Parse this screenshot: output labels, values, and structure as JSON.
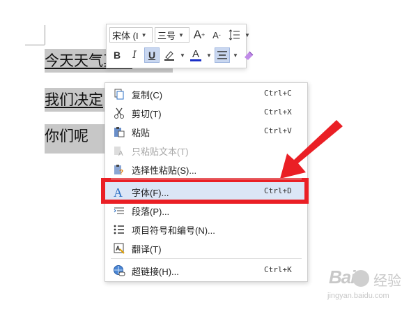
{
  "document": {
    "lines": [
      "今天天气真好",
      "我们决定",
      "你们呢"
    ]
  },
  "mini_toolbar": {
    "font_name": "宋体 (I",
    "font_size": "三号",
    "grow_font": "A",
    "shrink_font": "A",
    "bold": "B",
    "italic": "I",
    "underline": "U",
    "font_color": "A"
  },
  "context_menu": {
    "items": [
      {
        "label": "复制(C)",
        "shortcut": "Ctrl+C",
        "icon": "copy-icon",
        "enabled": true
      },
      {
        "label": "剪切(T)",
        "shortcut": "Ctrl+X",
        "icon": "scissors-icon",
        "enabled": true
      },
      {
        "label": "粘贴",
        "shortcut": "Ctrl+V",
        "icon": "paste-icon",
        "enabled": true
      },
      {
        "label": "只粘贴文本(T)",
        "shortcut": "",
        "icon": "paste-text-icon",
        "enabled": false
      },
      {
        "label": "选择性粘贴(S)...",
        "shortcut": "",
        "icon": "paste-special-icon",
        "enabled": true
      },
      {
        "label": "字体(F)...",
        "shortcut": "Ctrl+D",
        "icon": "font-icon",
        "enabled": true,
        "highlighted": true
      },
      {
        "label": "段落(P)...",
        "shortcut": "",
        "icon": "paragraph-icon",
        "enabled": true
      },
      {
        "label": "项目符号和编号(N)...",
        "shortcut": "",
        "icon": "list-icon",
        "enabled": true
      },
      {
        "label": "翻译(T)",
        "shortcut": "",
        "icon": "translate-icon",
        "enabled": true
      },
      {
        "label": "超链接(H)...",
        "shortcut": "Ctrl+K",
        "icon": "hyperlink-icon",
        "enabled": true
      }
    ]
  },
  "watermark": {
    "logo": "Bai",
    "brand_cn": "经验",
    "url": "jingyan.baidu.com"
  },
  "colors": {
    "selection": "#c7c7c7",
    "menu_highlight": "#dbe6f6",
    "annotation_red": "#ea1f25",
    "font_color_bar": "#1a2fc7"
  }
}
